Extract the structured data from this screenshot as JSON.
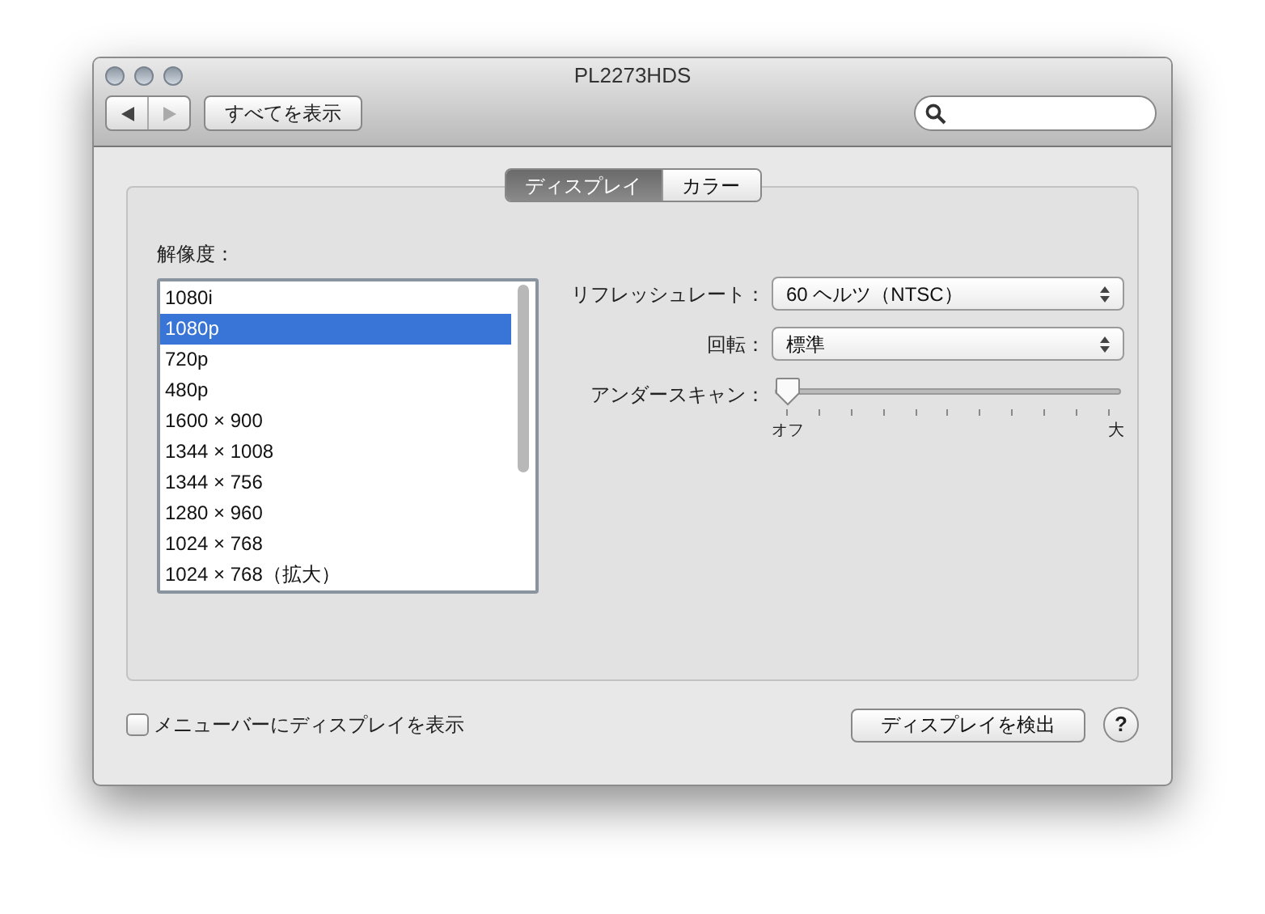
{
  "window": {
    "title": "PL2273HDS"
  },
  "toolbar": {
    "show_all_button": "すべてを表示"
  },
  "tabs": [
    {
      "label": "ディスプレイ",
      "selected": true
    },
    {
      "label": "カラー",
      "selected": false
    }
  ],
  "resolution": {
    "label": "解像度：",
    "items": [
      {
        "label": "1080i",
        "selected": false
      },
      {
        "label": "1080p",
        "selected": true
      },
      {
        "label": "720p",
        "selected": false
      },
      {
        "label": "480p",
        "selected": false
      },
      {
        "label": "1600 × 900",
        "selected": false
      },
      {
        "label": "1344 × 1008",
        "selected": false
      },
      {
        "label": "1344 × 756",
        "selected": false
      },
      {
        "label": "1280 × 960",
        "selected": false
      },
      {
        "label": "1024 × 768",
        "selected": false
      },
      {
        "label": "1024 × 768（拡大）",
        "selected": false
      }
    ]
  },
  "refresh_rate": {
    "label": "リフレッシュレート：",
    "value": "60 ヘルツ（NTSC）"
  },
  "rotation": {
    "label": "回転：",
    "value": "標準"
  },
  "underscan": {
    "label": "アンダースキャン：",
    "level": 0,
    "min_label": "オフ",
    "max_label": "大"
  },
  "menu_bar_checkbox": {
    "label": "メニューバーにディスプレイを表示",
    "checked": false
  },
  "detect_button": "ディスプレイを検出",
  "help_button": "?"
}
